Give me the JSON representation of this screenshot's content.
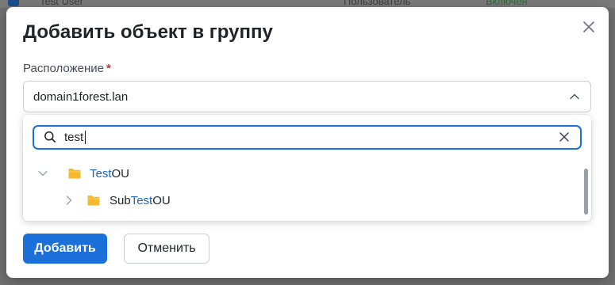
{
  "background_row": {
    "name": "Test User",
    "role": "Пользователь",
    "status": "Включен"
  },
  "modal": {
    "title": "Добавить объект в группу",
    "location_label": "Расположение",
    "required_mark": "*",
    "location_value": "domain1forest.lan",
    "search_value": "test",
    "tree": [
      {
        "level": 0,
        "expanded": true,
        "prefix": "",
        "match": "Test",
        "suffix": "OU",
        "icon": "folder-icon"
      },
      {
        "level": 1,
        "expanded": false,
        "prefix": "Sub",
        "match": "Test",
        "suffix": "OU",
        "icon": "folder-icon"
      }
    ],
    "add_label": "Добавить",
    "cancel_label": "Отменить"
  },
  "colors": {
    "primary": "#1a6fd8",
    "highlight": "#1a64c8",
    "folder": "#f5b82e",
    "required": "#d92b2b"
  }
}
